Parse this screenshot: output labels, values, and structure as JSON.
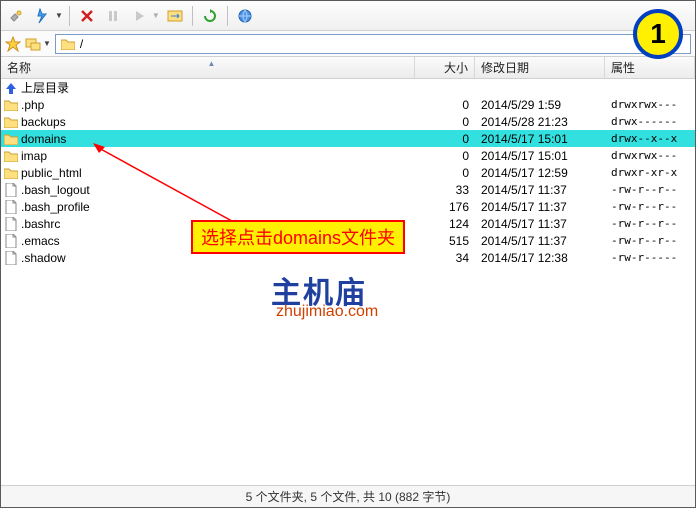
{
  "path": "/",
  "columns": {
    "name": "名称",
    "size": "大小",
    "date": "修改日期",
    "attr": "属性"
  },
  "parent_dir": "上层目录",
  "files": [
    {
      "type": "folder",
      "name": ".php",
      "size": "0",
      "date": "2014/5/29 1:59",
      "attr": "drwxrwx---",
      "sel": false
    },
    {
      "type": "folder",
      "name": "backups",
      "size": "0",
      "date": "2014/5/28 21:23",
      "attr": "drwx------",
      "sel": false
    },
    {
      "type": "folder",
      "name": "domains",
      "size": "0",
      "date": "2014/5/17 15:01",
      "attr": "drwx--x--x",
      "sel": true
    },
    {
      "type": "folder",
      "name": "imap",
      "size": "0",
      "date": "2014/5/17 15:01",
      "attr": "drwxrwx---",
      "sel": false
    },
    {
      "type": "folder",
      "name": "public_html",
      "size": "0",
      "date": "2014/5/17 12:59",
      "attr": "drwxr-xr-x",
      "sel": false
    },
    {
      "type": "file",
      "name": ".bash_logout",
      "size": "33",
      "date": "2014/5/17 11:37",
      "attr": "-rw-r--r--",
      "sel": false
    },
    {
      "type": "file",
      "name": ".bash_profile",
      "size": "176",
      "date": "2014/5/17 11:37",
      "attr": "-rw-r--r--",
      "sel": false
    },
    {
      "type": "file",
      "name": ".bashrc",
      "size": "124",
      "date": "2014/5/17 11:37",
      "attr": "-rw-r--r--",
      "sel": false
    },
    {
      "type": "file",
      "name": ".emacs",
      "size": "515",
      "date": "2014/5/17 11:37",
      "attr": "-rw-r--r--",
      "sel": false
    },
    {
      "type": "file",
      "name": ".shadow",
      "size": "34",
      "date": "2014/5/17 12:38",
      "attr": "-rw-r-----",
      "sel": false
    }
  ],
  "annotation": {
    "text": "选择点击domains文件夹"
  },
  "watermark": {
    "line1": "主机庙",
    "line2": "zhujimiao.com"
  },
  "badge": "1",
  "status": "5 个文件夹, 5 个文件, 共 10 (882 字节)"
}
